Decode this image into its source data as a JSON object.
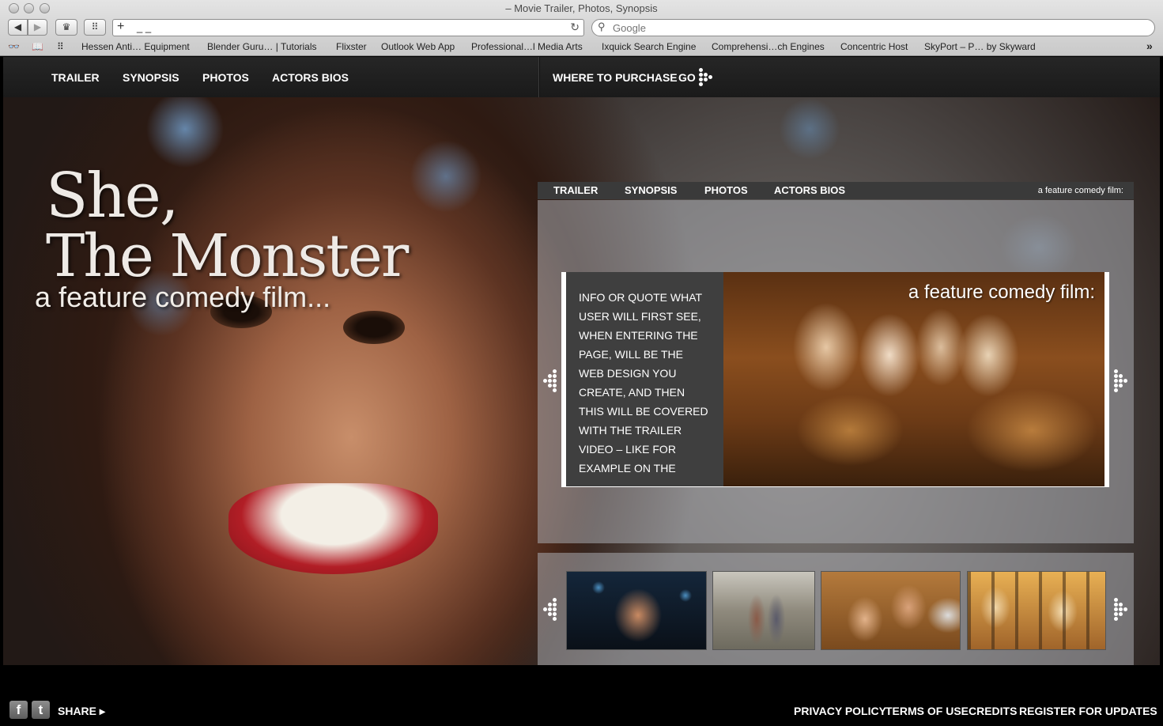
{
  "browser": {
    "window_title": "– Movie Trailer, Photos, Synopsis",
    "address_value": "_ _",
    "search_placeholder": "Google",
    "bookmarks": [
      "Hessen Anti… Equipment",
      "Blender Guru… | Tutorials",
      "Flixster",
      "Outlook Web App",
      "Professional…l Media Arts",
      "Ixquick Search Engine",
      "Comprehensi…ch Engines",
      "Concentric Host",
      "SkyPort – P… by Skyward"
    ],
    "more_bookmarks": "»"
  },
  "site": {
    "top_nav": {
      "trailer": "TRAILER",
      "synopsis": "SYNOPSIS",
      "photos": "PHOTOS",
      "actors_bios": "ACTORS BIOS",
      "where_to_purchase": "WHERE TO PURCHASE",
      "go": "GO"
    },
    "hero": {
      "title_line1": "She,",
      "title_line2": "The Monster",
      "subtitle": "a feature comedy film..."
    },
    "panel_nav": {
      "trailer": "TRAILER",
      "synopsis": "SYNOPSIS",
      "photos": "PHOTOS",
      "actors_bios": "ACTORS BIOS",
      "tagline": "a feature comedy film:"
    },
    "feature": {
      "quote": "INFO OR QUOTE WHAT USER WILL FIRST SEE, WHEN ENTERING THE PAGE, WILL BE THE WEB DESIGN YOU CREATE, AND THEN THIS WILL BE COVERED WITH THE TRAILER VIDEO – LIKE FOR EXAMPLE ON THE",
      "caption": "a feature comedy film:"
    },
    "footer": {
      "facebook": "f",
      "twitter": "t",
      "share": "SHARE ▸",
      "privacy_policy": "PRIVACY POLICY",
      "terms_of_use": "TERMS OF USE",
      "credits": "CREDITS",
      "register": "REGISTER FOR UPDATES"
    }
  }
}
